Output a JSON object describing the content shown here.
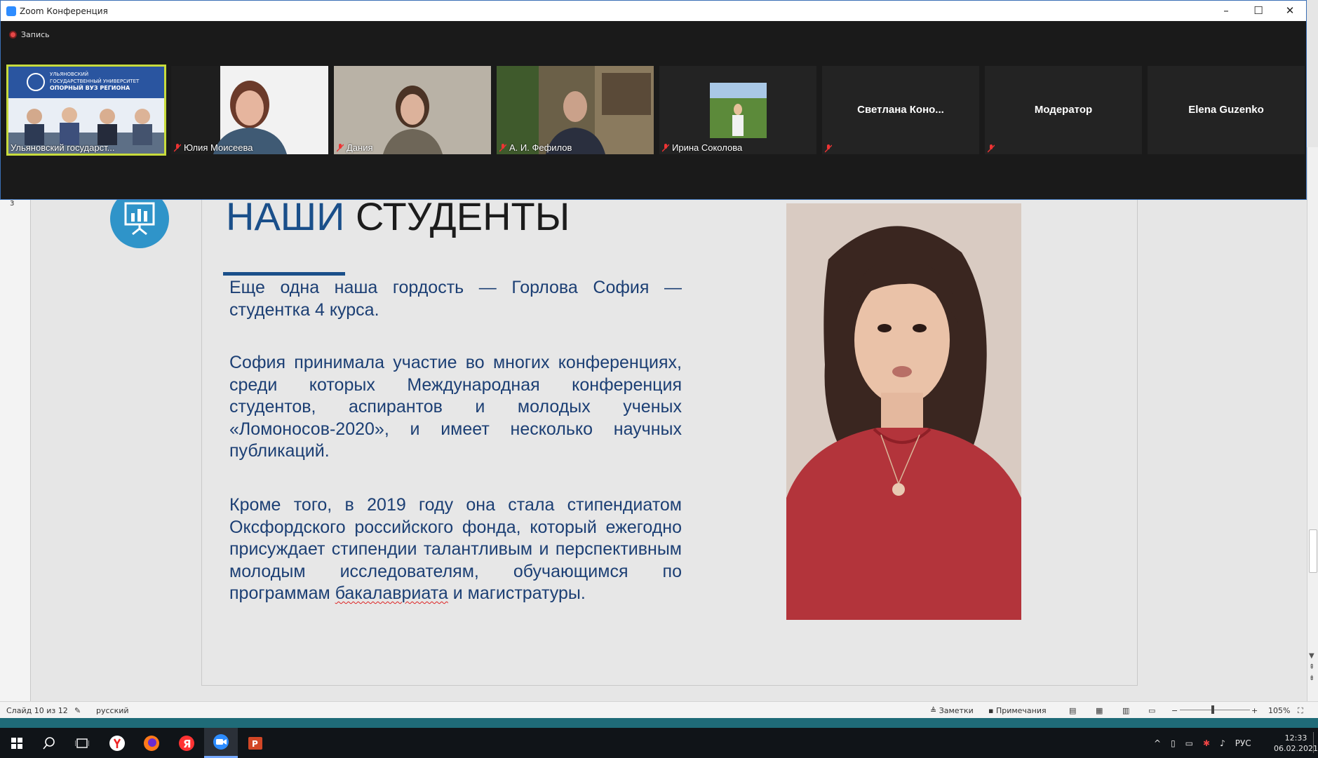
{
  "zoom": {
    "window_title": "Zoom Конференция",
    "recording_label": "Запись",
    "participants": [
      {
        "name": "Ульяновский государст...",
        "muted": false,
        "active_speaker": true,
        "video": true
      },
      {
        "name": "Юлия Моисеева",
        "muted": true,
        "video": true
      },
      {
        "name": "Дания",
        "muted": true,
        "video": true
      },
      {
        "name": "А. И. Фефилов",
        "muted": true,
        "video": true
      },
      {
        "name": "Ирина Соколова",
        "muted": true,
        "video": true
      },
      {
        "name": "Светлана  Коно...",
        "muted": true,
        "video": false
      },
      {
        "name": "Модератор",
        "muted": true,
        "video": false
      },
      {
        "name": "Elena Guzenko",
        "muted": false,
        "video": false
      }
    ],
    "banner_text": {
      "line1": "УЛЬЯНОВСКИЙ",
      "line2": "ГОСУДАРСТВЕННЫЙ УНИВЕРСИТЕТ",
      "line3": "ОПОРНЫЙ ВУЗ РЕГИОНА"
    }
  },
  "slide": {
    "title_part1": "НАШИ",
    "title_part2": "СТУДЕНТЫ",
    "paragraph1": "Еще одна наша гордость — Горлова София — студентка 4 курса.",
    "paragraph2": "София принимала участие во многих конференциях, среди которых Международная конференция студентов, аспирантов и молодых ученых «Ломоносов-2020», и имеет несколько научных публикаций.",
    "paragraph3_before": "Кроме того, в 2019 году она стала стипендиатом Оксфордского российского фонда, который ежегодно присуждает стипендии талантливым и перспективным молодым исследователям, обучающимся по программам ",
    "paragraph3_misspelled": "бакалавриата",
    "paragraph3_after": " и магистратуры.",
    "icon": "presentation-chart-icon",
    "accent_color": "#1a4f8a",
    "icon_color": "#2f94c9"
  },
  "statusbar": {
    "slide_counter": "Слайд 10 из 12",
    "language": "русский",
    "notes_label": "Заметки",
    "comments_label": "Примечания",
    "zoom_level": "105%"
  },
  "taskbar": {
    "time": "12:33",
    "date": "06.02.2021",
    "input_lang": "РУС",
    "apps": [
      "windows-start-icon",
      "search-icon",
      "task-view-icon",
      "yandex-browser-icon",
      "firefox-icon",
      "yandex-icon",
      "zoom-icon",
      "powerpoint-icon"
    ]
  }
}
